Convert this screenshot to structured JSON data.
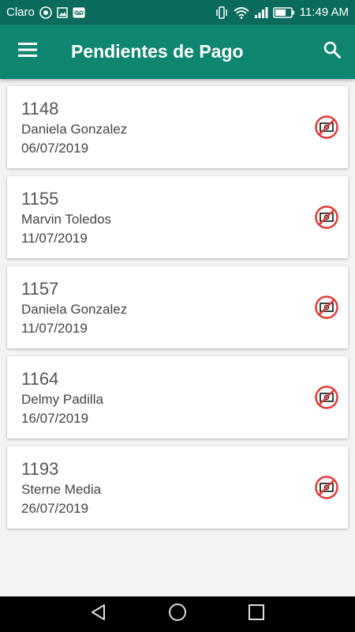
{
  "status_bar": {
    "carrier": "Claro",
    "time": "11:49 AM"
  },
  "app_bar": {
    "title": "Pendientes de Pago",
    "menu_icon": "hamburger-menu-icon",
    "search_icon": "search-icon"
  },
  "colors": {
    "status_bar": "#0a6b5c",
    "app_bar": "#0f8670",
    "no_payment_icon": "#e53935",
    "background": "#f3f3f3"
  },
  "items": [
    {
      "number": "1148",
      "name": "Daniela Gonzalez",
      "date": "06/07/2019",
      "icon": "no-payment-icon"
    },
    {
      "number": "1155",
      "name": "Marvin Toledos",
      "date": "11/07/2019",
      "icon": "no-payment-icon"
    },
    {
      "number": "1157",
      "name": "Daniela Gonzalez",
      "date": "11/07/2019",
      "icon": "no-payment-icon"
    },
    {
      "number": "1164",
      "name": "Delmy Padilla",
      "date": "16/07/2019",
      "icon": "no-payment-icon"
    },
    {
      "number": "1193",
      "name": "Sterne Media",
      "date": "26/07/2019",
      "icon": "no-payment-icon"
    }
  ],
  "nav_bar": {
    "back_icon": "back-icon",
    "home_icon": "home-icon",
    "recents_icon": "recents-icon"
  }
}
